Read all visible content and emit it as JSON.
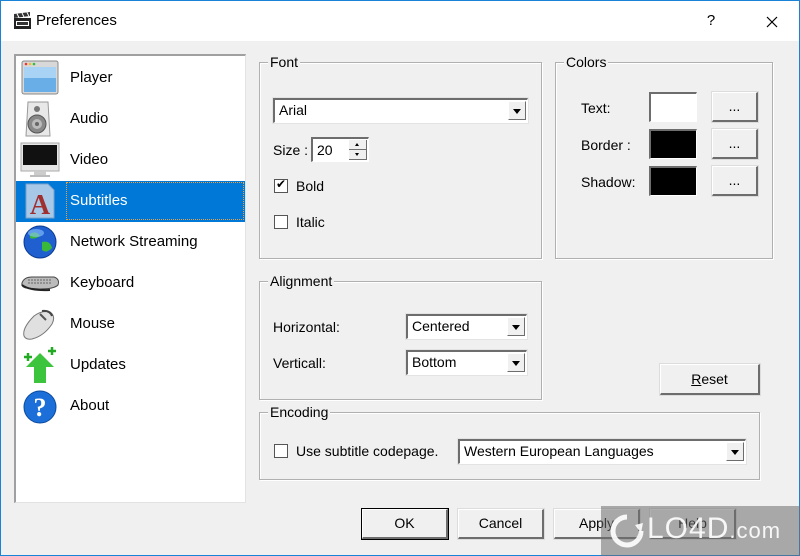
{
  "window": {
    "title": "Preferences",
    "help_label": "?",
    "close_label": "✕"
  },
  "sidebar": {
    "selected_index": 3,
    "items": [
      {
        "label": "Player",
        "icon": "player-window-icon"
      },
      {
        "label": "Audio",
        "icon": "speaker-icon"
      },
      {
        "label": "Video",
        "icon": "monitor-icon"
      },
      {
        "label": "Subtitles",
        "icon": "subtitles-document-icon"
      },
      {
        "label": "Network Streaming",
        "icon": "globe-icon"
      },
      {
        "label": "Keyboard",
        "icon": "keyboard-icon"
      },
      {
        "label": "Mouse",
        "icon": "mouse-icon"
      },
      {
        "label": "Updates",
        "icon": "update-arrow-icon"
      },
      {
        "label": "About",
        "icon": "help-question-icon"
      }
    ]
  },
  "font_group": {
    "title": "Font",
    "font_name": "Arial",
    "size_label": "Size  :",
    "size_value": "20",
    "bold_label": "Bold",
    "bold_checked": true,
    "italic_label": "Italic",
    "italic_checked": false
  },
  "colors_group": {
    "title": "Colors",
    "text_label": "Text:",
    "text_color": "#ffffff",
    "border_label": "Border :",
    "border_color": "#000000",
    "shadow_label": "Shadow:",
    "shadow_color": "#000000",
    "pick_label": "..."
  },
  "alignment_group": {
    "title": "Alignment",
    "horizontal_label": "Horizontal:",
    "horizontal_value": "Centered",
    "vertical_label": "Verticall:",
    "vertical_value": "Bottom"
  },
  "reset_button": {
    "prefix": "",
    "mnemonic": "R",
    "rest": "eset"
  },
  "encoding_group": {
    "title": "Encoding",
    "codepage_label": "Use subtitle codepage.",
    "codepage_checked": false,
    "codepage_value": "Western European Languages"
  },
  "footer": {
    "ok_label": "OK",
    "cancel_label": "Cancel",
    "apply_label": "Apply",
    "help_label": "Help"
  },
  "watermark": {
    "brand": "LO4D",
    "suffix": ".com"
  }
}
